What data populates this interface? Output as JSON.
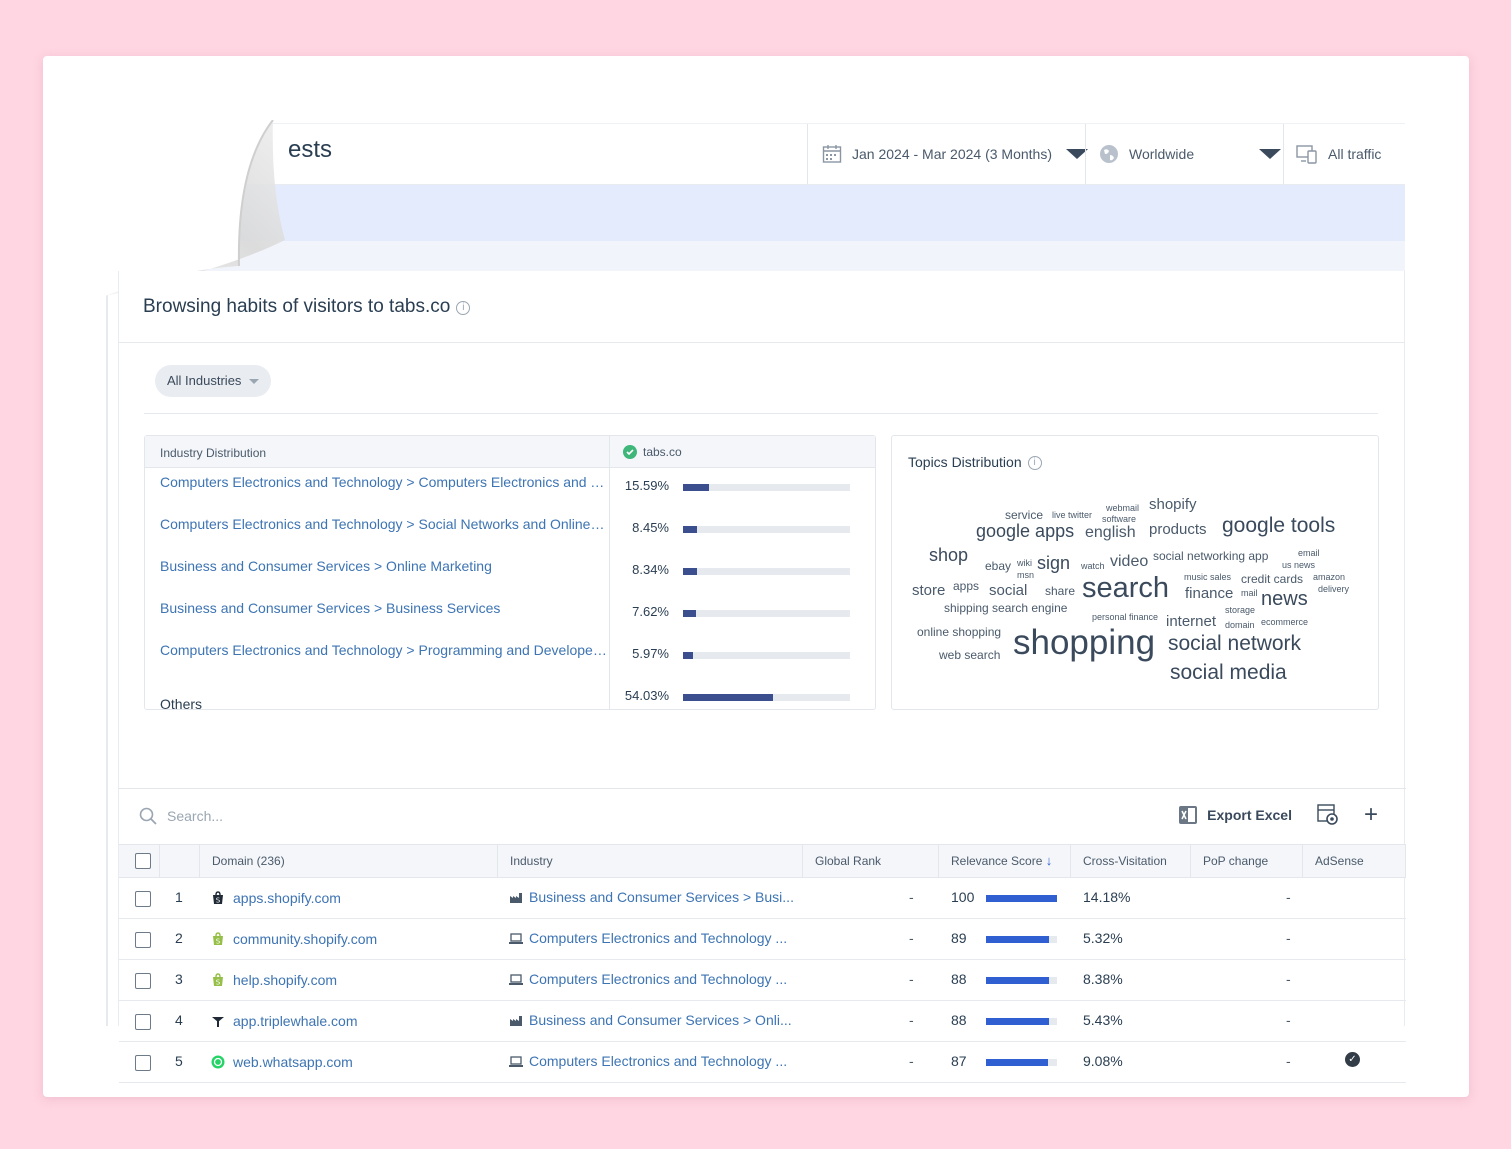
{
  "header": {
    "title_partial": "ests",
    "date_range": "Jan 2024 - Mar 2024 (3 Months)",
    "region": "Worldwide",
    "traffic": "All traffic"
  },
  "section": {
    "title": "Browsing habits of visitors to tabs.co",
    "filter_chip": "All Industries"
  },
  "industry_distribution": {
    "header_label": "Industry Distribution",
    "site_label": "tabs.co",
    "rows": [
      {
        "label": "Computers Electronics and Technology > Computers Electronics and T...",
        "pct": "15.59%",
        "value": 15.59
      },
      {
        "label": "Computers Electronics and Technology > Social Networks and Online C...",
        "pct": "8.45%",
        "value": 8.45
      },
      {
        "label": "Business and Consumer Services > Online Marketing",
        "pct": "8.34%",
        "value": 8.34
      },
      {
        "label": "Business and Consumer Services > Business Services",
        "pct": "7.62%",
        "value": 7.62
      },
      {
        "label": "Computers Electronics and Technology > Programming and Developer ...",
        "pct": "5.97%",
        "value": 5.97
      },
      {
        "label": "Others",
        "pct": "54.03%",
        "value": 54.03
      }
    ]
  },
  "topics": {
    "title": "Topics Distribution",
    "words": [
      "service",
      "live twitter",
      "webmail",
      "software",
      "shopify",
      "google apps",
      "english",
      "products",
      "google tools",
      "shop",
      "ebay",
      "wiki",
      "msn",
      "sign",
      "watch",
      "video",
      "social networking app",
      "email",
      "us news",
      "store",
      "apps",
      "social",
      "share",
      "search",
      "music sales",
      "credit cards",
      "amazon",
      "finance",
      "mail",
      "delivery",
      "news",
      "shipping search engine",
      "personal finance",
      "internet",
      "storage",
      "domain",
      "ecommerce",
      "online shopping",
      "shopping",
      "social network",
      "web search",
      "social media"
    ]
  },
  "table": {
    "search_placeholder": "Search...",
    "export_label": "Export Excel",
    "columns": [
      "Domain (236)",
      "Industry",
      "Global Rank",
      "Relevance Score",
      "Cross-Visitation",
      "PoP change",
      "AdSense"
    ],
    "rows": [
      {
        "num": "1",
        "domain": "apps.shopify.com",
        "industry": "Business and Consumer Services > Busi...",
        "rank": "-",
        "score": "100",
        "score_value": 100,
        "cross": "14.18%",
        "pop": "-",
        "adsense": false
      },
      {
        "num": "2",
        "domain": "community.shopify.com",
        "industry": "Computers Electronics and Technology ...",
        "rank": "-",
        "score": "89",
        "score_value": 89,
        "cross": "5.32%",
        "pop": "-",
        "adsense": false
      },
      {
        "num": "3",
        "domain": "help.shopify.com",
        "industry": "Computers Electronics and Technology ...",
        "rank": "-",
        "score": "88",
        "score_value": 88,
        "cross": "8.38%",
        "pop": "-",
        "adsense": false
      },
      {
        "num": "4",
        "domain": "app.triplewhale.com",
        "industry": "Business and Consumer Services > Onli...",
        "rank": "-",
        "score": "88",
        "score_value": 88,
        "cross": "5.43%",
        "pop": "-",
        "adsense": false
      },
      {
        "num": "5",
        "domain": "web.whatsapp.com",
        "industry": "Computers Electronics and Technology ...",
        "rank": "-",
        "score": "87",
        "score_value": 87,
        "cross": "9.08%",
        "pop": "-",
        "adsense": true
      }
    ]
  },
  "colors": {
    "link": "#3d74b3",
    "bar_dark": "#3b4f8f",
    "bar_blue": "#2f5fd0",
    "band": "#e3ebfd",
    "bg": "#ffd6e2"
  }
}
